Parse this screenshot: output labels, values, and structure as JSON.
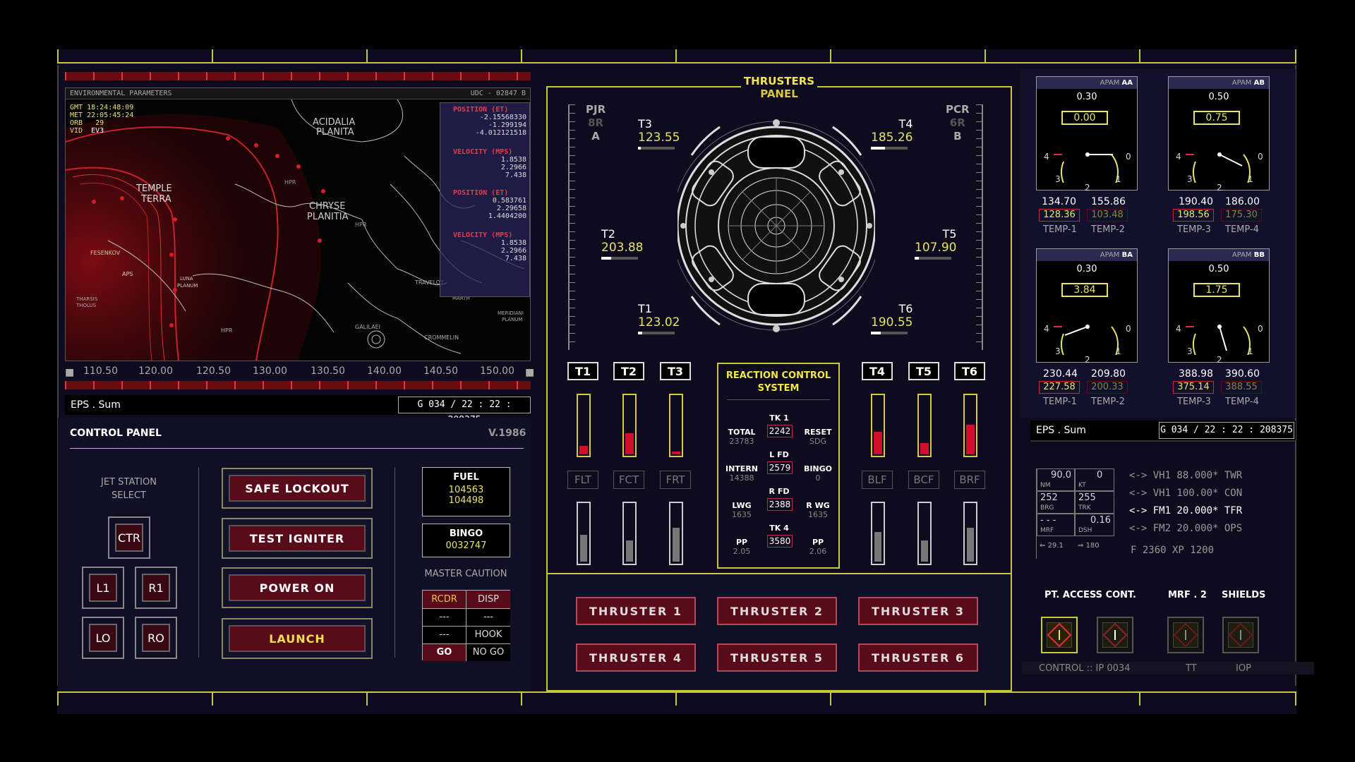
{
  "map": {
    "header": "ENVIRONMENTAL PARAMETERS",
    "code": "UDC - 02847 B",
    "info": [
      {
        "k": "GMT",
        "v": "18:24:48:09"
      },
      {
        "k": "MET",
        "v": "22:05:45:24"
      },
      {
        "k": "ORB",
        "v": "29"
      },
      {
        "k": "VID",
        "v": "EV3"
      }
    ],
    "places": [
      "ACIDALIA PLANITA",
      "TEMPLE TERRA",
      "CHRYSE PLANITIA",
      "HPR",
      "HPR",
      "FESENKOV",
      "APS",
      "LUNA PLANUM",
      "THARSIS THOLUS",
      "TRAVELOT",
      "GALILAEI",
      "CROMMELIN",
      "MERIDIANI PLANUM",
      "MARTH",
      "HPR"
    ],
    "side": {
      "pos1_title": "POSITION (ET)",
      "pos1": [
        "-2.15568330",
        "-1.299194",
        "-4.012121518"
      ],
      "vel1_title": "VELOCITY (MPS)",
      "vel1": [
        "1.8538",
        "2.2966",
        "7.438"
      ],
      "pos2_title": "POSITION (ET)",
      "pos2": [
        "0.583761",
        "2.29658",
        "1.4404200"
      ],
      "vel2_title": "VELOCITY (MPS)",
      "vel2": [
        "1.8538",
        "2.2966",
        "7.438"
      ]
    },
    "scale": [
      "110.50",
      "120.00",
      "120.50",
      "130.00",
      "130.50",
      "140.00",
      "140.50",
      "150.00"
    ]
  },
  "eps": {
    "label": "EPS . Sum",
    "code": "G 034 / 22 : 22 : 208375"
  },
  "control": {
    "title": "CONTROL PANEL",
    "version": "V.1986",
    "jet_title": "JET STATION SELECT",
    "jet": [
      "CTR",
      "L1",
      "R1",
      "LO",
      "RO"
    ],
    "buttons": [
      "SAFE LOCKOUT",
      "TEST IGNITER",
      "POWER ON",
      "LAUNCH"
    ],
    "fuel_title": "FUEL",
    "fuel": [
      "104563",
      "104498"
    ],
    "bingo_title": "BINGO",
    "bingo": "0032747",
    "caution_title": "MASTER CAUTION",
    "caution": [
      [
        "RCDR",
        "DISP"
      ],
      [
        "---",
        "---"
      ],
      [
        "---",
        "HOOK"
      ],
      [
        "GO",
        "NO GO"
      ]
    ]
  },
  "thrusters": {
    "title": "THRUSTERS",
    "sub": "PANEL",
    "pjr": [
      "PJR",
      "8R",
      "A"
    ],
    "pcr": [
      "PCR",
      "6R",
      "B"
    ],
    "readouts": [
      {
        "n": "T3",
        "v": "123.55"
      },
      {
        "n": "T4",
        "v": "185.26"
      },
      {
        "n": "T2",
        "v": "203.88"
      },
      {
        "n": "T5",
        "v": "107.90"
      },
      {
        "n": "T1",
        "v": "123.02"
      },
      {
        "n": "T6",
        "v": "190.55"
      }
    ],
    "bars": [
      "T1",
      "T2",
      "T3",
      "T4",
      "T5",
      "T6"
    ],
    "sublabels": [
      "FLT",
      "FCT",
      "FRT",
      "BLF",
      "BCF",
      "BRF"
    ],
    "rcs_title": "REACTION CONTROL SYSTEM",
    "rcs": {
      "tk1": "TK 1",
      "tk1v": "2242",
      "lfd": "L FD",
      "lfdv": "2579",
      "rfd": "R FD",
      "rfdv": "2388",
      "tk4": "TK 4",
      "tk4v": "3580",
      "total": "TOTAL",
      "totalv": "23783",
      "reset": "RESET",
      "resetv": "SDG",
      "intern": "INTERN",
      "internv": "14388",
      "bingo": "BINGO",
      "bingov": "0",
      "lwg": "LWG",
      "lwgv": "1635",
      "rwg": "R WG",
      "rwgv": "1635",
      "ppl": "PP",
      "pplv": "2.05",
      "ppr": "PP",
      "pprv": "2.06"
    },
    "buttons": [
      "THRUSTER 1",
      "THRUSTER 2",
      "THRUSTER 3",
      "THRUSTER 4",
      "THRUSTER 5",
      "THRUSTER 6"
    ]
  },
  "apam": [
    {
      "hdr": "APAM",
      "id": "AA",
      "top": "0.30",
      "val": "0.00",
      "a": "134.70",
      "b": "155.86",
      "c": "128.36",
      "d": "103.48",
      "l1": "TEMP-1",
      "l2": "TEMP-2"
    },
    {
      "hdr": "APAM",
      "id": "AB",
      "top": "0.50",
      "val": "0.75",
      "a": "190.40",
      "b": "186.00",
      "c": "198.56",
      "d": "175.30",
      "l1": "TEMP-3",
      "l2": "TEMP-4"
    },
    {
      "hdr": "APAM",
      "id": "BA",
      "top": "0.30",
      "val": "3.84",
      "a": "230.44",
      "b": "209.80",
      "c": "227.58",
      "d": "200.33",
      "l1": "TEMP-1",
      "l2": "TEMP-2"
    },
    {
      "hdr": "APAM",
      "id": "BB",
      "top": "0.50",
      "val": "1.75",
      "a": "388.98",
      "b": "390.60",
      "c": "375.14",
      "d": "388.55",
      "l1": "TEMP-3",
      "l2": "TEMP-4"
    }
  ],
  "gauge_ticks": [
    "4",
    "0",
    "3",
    "1",
    "2"
  ],
  "nav": {
    "grid": [
      {
        "v": "90.0",
        "l": "NM"
      },
      {
        "v": "0",
        "l": "KT"
      },
      {
        "v": "252",
        "l": "BRG"
      },
      {
        "v": "255",
        "l": "TRK"
      },
      {
        "v": "- - -",
        "l": "MRF"
      },
      {
        "v": "0.16",
        "l": "DSH"
      }
    ],
    "foot": [
      "29.1",
      "180"
    ],
    "lines": [
      "VH1  88.000*  TWR",
      "VH1  100.00*  CON",
      "FM1  20.000*  TFR",
      "FM2  20.000*  OPS"
    ],
    "bottom": "F  2360   XP   1200"
  },
  "access": {
    "t1": "PT. ACCESS CONT.",
    "t2": "MRF . 2",
    "t3": "SHIELDS",
    "f1": "CONTROL :: IP  0034",
    "f2": "TT",
    "f3": "IOP"
  }
}
